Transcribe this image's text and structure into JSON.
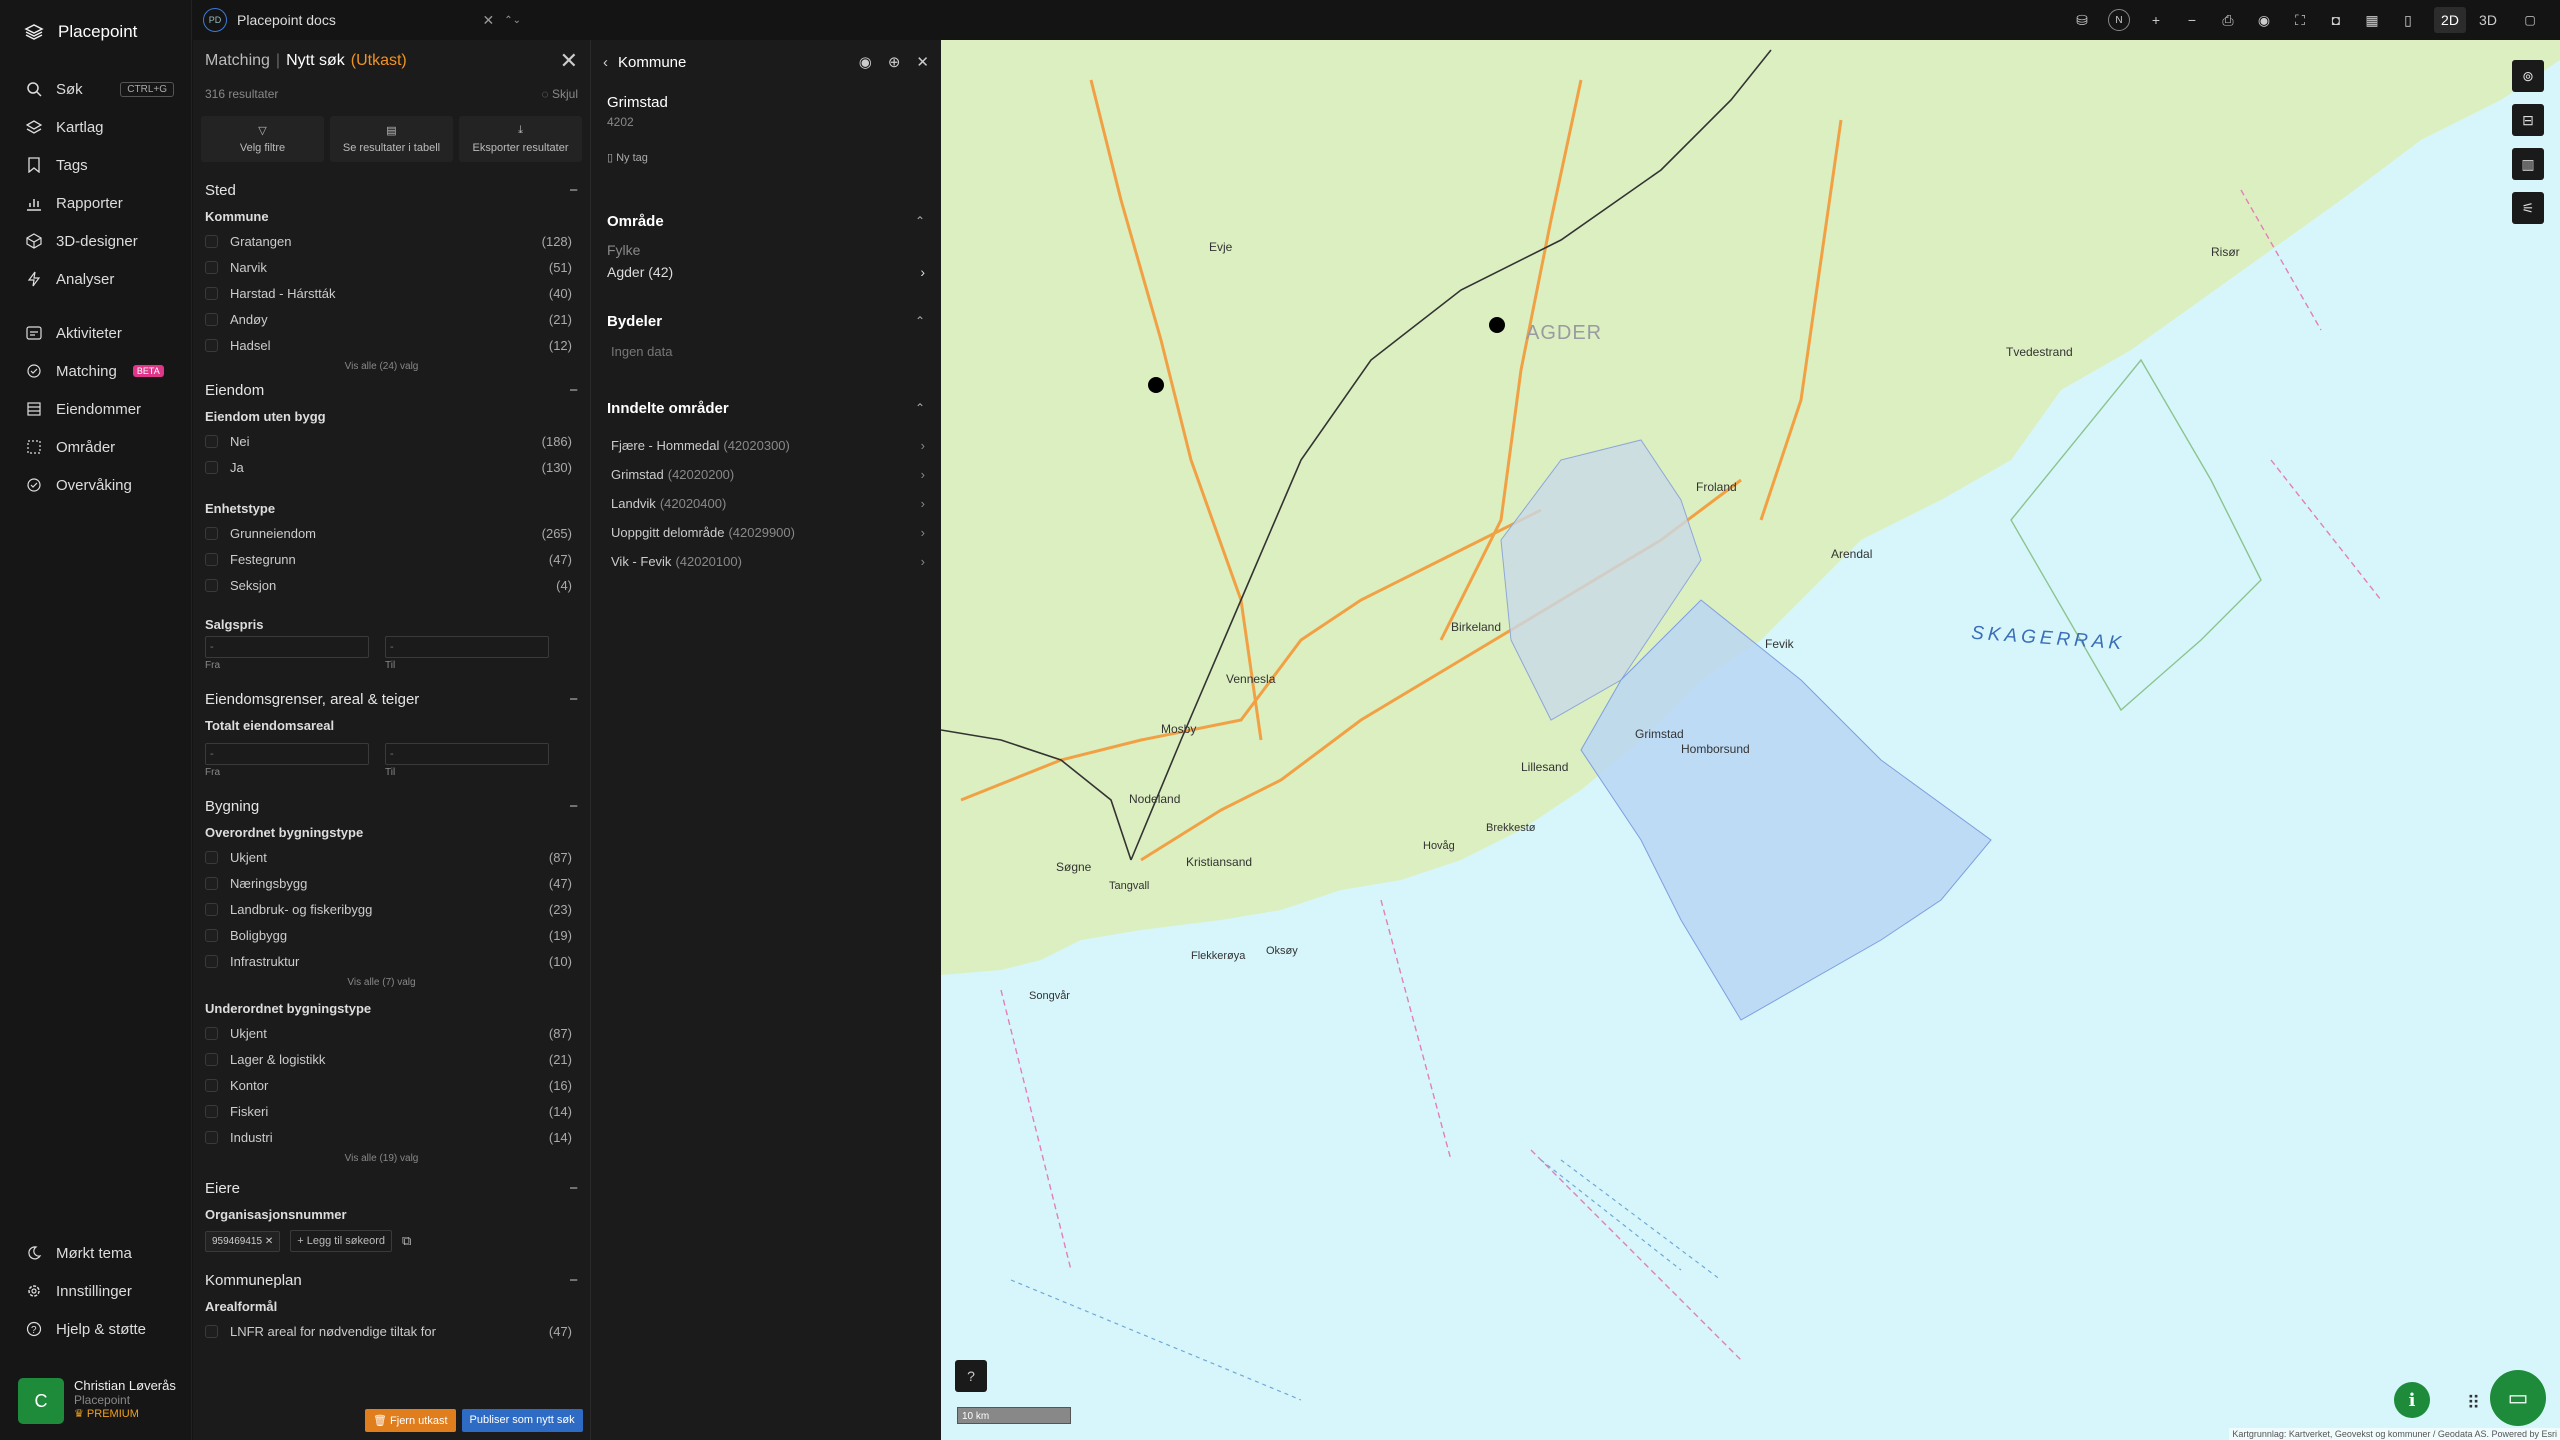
{
  "app": {
    "name": "Placepoint"
  },
  "sidebar": {
    "items": [
      {
        "label": "Søk",
        "icon": "search-icon",
        "shortcut": "CTRL+G"
      },
      {
        "label": "Kartlag",
        "icon": "layers-icon"
      },
      {
        "label": "Tags",
        "icon": "bookmark-icon"
      },
      {
        "label": "Rapporter",
        "icon": "chart-icon"
      },
      {
        "label": "3D-designer",
        "icon": "cube-icon"
      },
      {
        "label": "Analyser",
        "icon": "bolt-icon"
      },
      {
        "label": "Aktiviteter",
        "icon": "activity-icon"
      },
      {
        "label": "Matching",
        "icon": "matching-icon",
        "badge": "BETA"
      },
      {
        "label": "Eiendommer",
        "icon": "building-icon"
      },
      {
        "label": "Områder",
        "icon": "area-icon"
      },
      {
        "label": "Overvåking",
        "icon": "monitor-icon"
      }
    ],
    "bottom_items": [
      {
        "label": "Mørkt tema",
        "icon": "moon-icon"
      },
      {
        "label": "Innstillinger",
        "icon": "gear-icon"
      },
      {
        "label": "Hjelp & støtte",
        "icon": "help-icon"
      }
    ],
    "user": {
      "initial": "C",
      "name": "Christian Løverås",
      "org": "Placepoint",
      "plan": "PREMIUM"
    }
  },
  "topbar": {
    "tab_badge": "PD",
    "tab_title": "Placepoint docs",
    "compass": "N",
    "mode_2d": "2D",
    "mode_3d": "3D"
  },
  "filter": {
    "breadcrumb": "Matching",
    "title": "Nytt søk",
    "status": "(Utkast)",
    "results": "316 resultater",
    "hide": "Skjul",
    "actions": [
      "Velg filtre",
      "Se resultater i tabell",
      "Eksporter resultater"
    ],
    "sections": {
      "sted": "Sted",
      "kommune": "Kommune",
      "kommune_items": [
        {
          "label": "Gratangen",
          "count": "(128)"
        },
        {
          "label": "Narvik",
          "count": "(51)"
        },
        {
          "label": "Harstad - Hárstták",
          "count": "(40)"
        },
        {
          "label": "Andøy",
          "count": "(21)"
        },
        {
          "label": "Hadsel",
          "count": "(12)"
        }
      ],
      "kommune_more": "Vis alle (24) valg",
      "eiendom": "Eiendom",
      "uten_bygg": "Eiendom uten bygg",
      "uten_bygg_items": [
        {
          "label": "Nei",
          "count": "(186)"
        },
        {
          "label": "Ja",
          "count": "(130)"
        }
      ],
      "enhetstype": "Enhetstype",
      "enhetstype_items": [
        {
          "label": "Grunneiendom",
          "count": "(265)"
        },
        {
          "label": "Festegrunn",
          "count": "(47)"
        },
        {
          "label": "Seksjon",
          "count": "(4)"
        }
      ],
      "salgspris": "Salgspris",
      "fra": "Fra",
      "til": "Til",
      "placeholder": "-",
      "grenser": "Eiendomsgrenser, areal & teiger",
      "totalt_areal": "Totalt eiendomsareal",
      "bygning": "Bygning",
      "overordnet": "Overordnet bygningstype",
      "overordnet_items": [
        {
          "label": "Ukjent",
          "count": "(87)"
        },
        {
          "label": "Næringsbygg",
          "count": "(47)"
        },
        {
          "label": "Landbruk- og fiskeribygg",
          "count": "(23)"
        },
        {
          "label": "Boligbygg",
          "count": "(19)"
        },
        {
          "label": "Infrastruktur",
          "count": "(10)"
        }
      ],
      "overordnet_more": "Vis alle (7) valg",
      "underordnet": "Underordnet bygningstype",
      "underordnet_items": [
        {
          "label": "Ukjent",
          "count": "(87)"
        },
        {
          "label": "Lager & logistikk",
          "count": "(21)"
        },
        {
          "label": "Kontor",
          "count": "(16)"
        },
        {
          "label": "Fiskeri",
          "count": "(14)"
        },
        {
          "label": "Industri",
          "count": "(14)"
        }
      ],
      "underordnet_more": "Vis alle (19) valg",
      "eiere": "Eiere",
      "orgnr": "Organisasjonsnummer",
      "orgnr_chip": "959469415",
      "add_keyword": "Legg til søkeord",
      "kommuneplan": "Kommuneplan",
      "arealformal": "Arealformål",
      "arealformal_item": {
        "label": "LNFR areal for nødvendige tiltak for",
        "count": "(47)"
      }
    },
    "btn_remove": "Fjern utkast",
    "btn_publish": "Publiser som nytt søk"
  },
  "detail": {
    "header": "Kommune",
    "name": "Grimstad",
    "code": "4202",
    "new_tag": "Ny tag",
    "omrade": "Område",
    "fylke_label": "Fylke",
    "fylke_value": "Agder (42)",
    "bydeler": "Bydeler",
    "ingen_data": "Ingen data",
    "inndelte": "Inndelte områder",
    "areas": [
      {
        "name": "Fjære - Hommedal",
        "code": "(42020300)"
      },
      {
        "name": "Grimstad",
        "code": "(42020200)"
      },
      {
        "name": "Landvik",
        "code": "(42020400)"
      },
      {
        "name": "Uoppgitt delområde",
        "code": "(42029900)"
      },
      {
        "name": "Vik - Fevik",
        "code": "(42020100)"
      }
    ]
  },
  "map": {
    "labels": [
      "AGDER",
      "SKAGERRAK",
      "Kristiansand",
      "Grimstad",
      "Arendal",
      "Lillesand",
      "Birkeland",
      "Vennesla",
      "Mosby",
      "Evje",
      "Froland",
      "Tvedestrand",
      "Risør",
      "Homborsund",
      "Fevik",
      "Nodeland",
      "Søgne",
      "Songvår",
      "Flekkerøya",
      "Tangvall",
      "Hovåg",
      "Brekkestø",
      "Oksøy"
    ],
    "scale": "10 km",
    "attribution": "Kartgrunnlag: Kartverket, Geovekst og kommuner / Geodata AS. Powered by Esri",
    "colors": {
      "land": "#dcefc0",
      "sea": "#d7f6fb",
      "road": "#f1a144",
      "selection": "#b8d4f5"
    }
  }
}
